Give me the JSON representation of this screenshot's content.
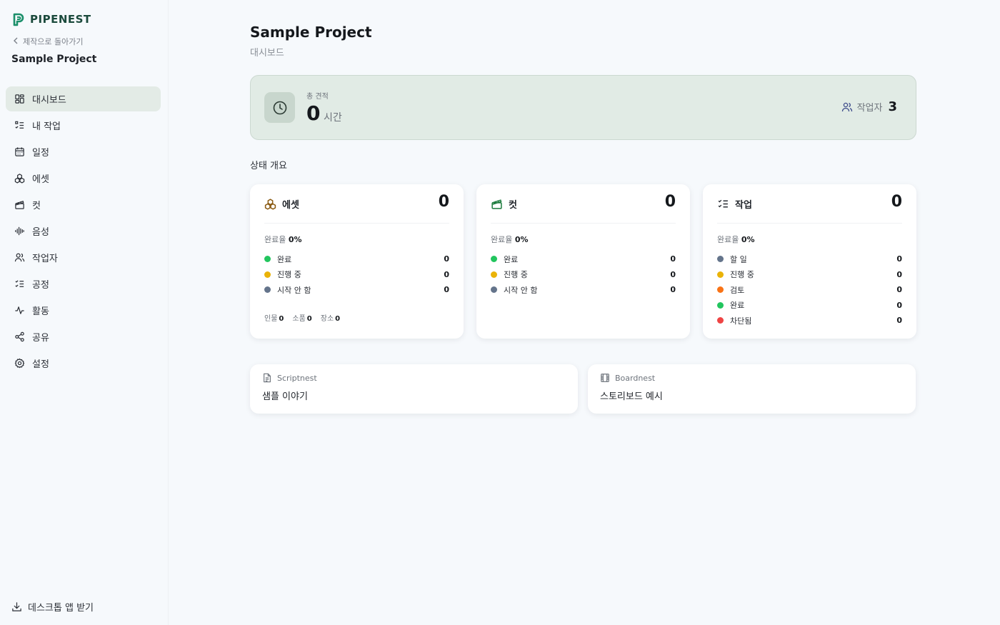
{
  "app": {
    "name": "PIPENEST",
    "accent": "#1b8f6a"
  },
  "sidebar": {
    "back_label": "제작으로 돌아가기",
    "project_name": "Sample Project",
    "items": [
      {
        "label": "대시보드",
        "icon": "dashboard-icon",
        "active": true
      },
      {
        "label": "내 작업",
        "icon": "task-list-icon"
      },
      {
        "label": "일정",
        "icon": "calendar-icon"
      },
      {
        "label": "에셋",
        "icon": "assets-icon"
      },
      {
        "label": "컷",
        "icon": "clapper-icon"
      },
      {
        "label": "음성",
        "icon": "audio-wave-icon"
      },
      {
        "label": "작업자",
        "icon": "users-icon"
      },
      {
        "label": "공정",
        "icon": "checklist-icon"
      },
      {
        "label": "활동",
        "icon": "activity-icon"
      },
      {
        "label": "공유",
        "icon": "share-icon"
      },
      {
        "label": "설정",
        "icon": "gear-icon"
      }
    ],
    "download_label": "데스크톱 앱 받기"
  },
  "header": {
    "title": "Sample Project",
    "subtitle": "대시보드"
  },
  "summary": {
    "label": "총 견적",
    "value": "0",
    "unit": "시간",
    "workers_label": "작업자",
    "workers_count": "3"
  },
  "section_title": "상태 개요",
  "cards": {
    "assets": {
      "name": "에셋",
      "total": "0",
      "rate_label": "완료율",
      "rate_value": "0%",
      "statuses": [
        {
          "label": "완료",
          "count": "0",
          "color": "#22c55e"
        },
        {
          "label": "진행 중",
          "count": "0",
          "color": "#eab308"
        },
        {
          "label": "시작 안 함",
          "count": "0",
          "color": "#64748b"
        }
      ],
      "meta": [
        {
          "label": "인물",
          "value": "0"
        },
        {
          "label": "소품",
          "value": "0"
        },
        {
          "label": "장소",
          "value": "0"
        }
      ]
    },
    "cuts": {
      "name": "컷",
      "total": "0",
      "rate_label": "완료율",
      "rate_value": "0%",
      "statuses": [
        {
          "label": "완료",
          "count": "0",
          "color": "#22c55e"
        },
        {
          "label": "진행 중",
          "count": "0",
          "color": "#eab308"
        },
        {
          "label": "시작 안 함",
          "count": "0",
          "color": "#64748b"
        }
      ]
    },
    "tasks": {
      "name": "작업",
      "total": "0",
      "rate_label": "완료율",
      "rate_value": "0%",
      "statuses": [
        {
          "label": "할 일",
          "count": "0",
          "color": "#64748b"
        },
        {
          "label": "진행 중",
          "count": "0",
          "color": "#eab308"
        },
        {
          "label": "검토",
          "count": "0",
          "color": "#f97316"
        },
        {
          "label": "완료",
          "count": "0",
          "color": "#22c55e"
        },
        {
          "label": "차단됨",
          "count": "0",
          "color": "#ef4444"
        }
      ]
    }
  },
  "links": [
    {
      "source": "Scriptnest",
      "title": "샘플 이야기",
      "icon": "document-icon"
    },
    {
      "source": "Boardnest",
      "title": "스토리보드 예시",
      "icon": "film-icon"
    }
  ]
}
